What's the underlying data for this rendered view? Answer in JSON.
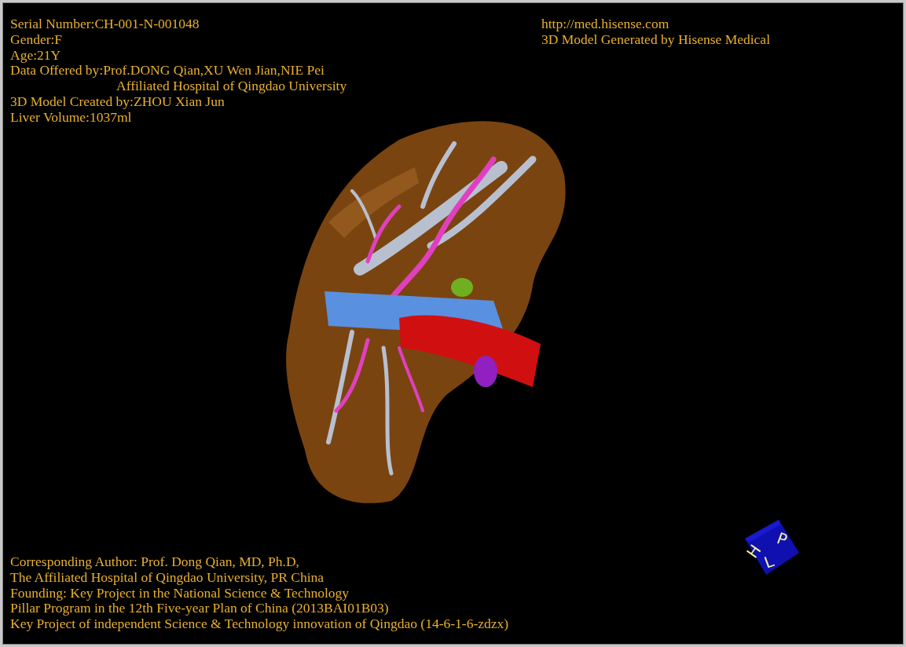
{
  "info_top_left": [
    {
      "kind": "line",
      "text": "Serial Number:CH-001-N-001048"
    },
    {
      "kind": "line",
      "text": "Gender:F"
    },
    {
      "kind": "line",
      "text": "Age:21Y"
    },
    {
      "kind": "line",
      "text": "Data Offered by:Prof.DONG Qian,XU Wen Jian,NIE Pei"
    },
    {
      "kind": "continuation",
      "text": "Affiliated Hospital of Qingdao University"
    },
    {
      "kind": "line",
      "text": "3D Model Created by:ZHOU Xian Jun"
    },
    {
      "kind": "line",
      "text": "Liver Volume:1037ml"
    }
  ],
  "info_top_right": [
    "http://med.hisense.com",
    "3D Model Generated by Hisense Medical"
  ],
  "info_bottom": [
    "Corresponding Author: Prof. Dong Qian, MD, Ph.D,",
    "The Affiliated Hospital of Qingdao University, PR China",
    "Founding: Key Project in the National Science & Technology",
    "Pillar Program in the 12th Five-year Plan of China (2013BAI01B03)",
    "Key Project of independent Science & Technology innovation of Qingdao (14-6-1-6-zdzx)"
  ],
  "orientation_cube": {
    "faces": [
      "H",
      "P",
      "L"
    ]
  }
}
